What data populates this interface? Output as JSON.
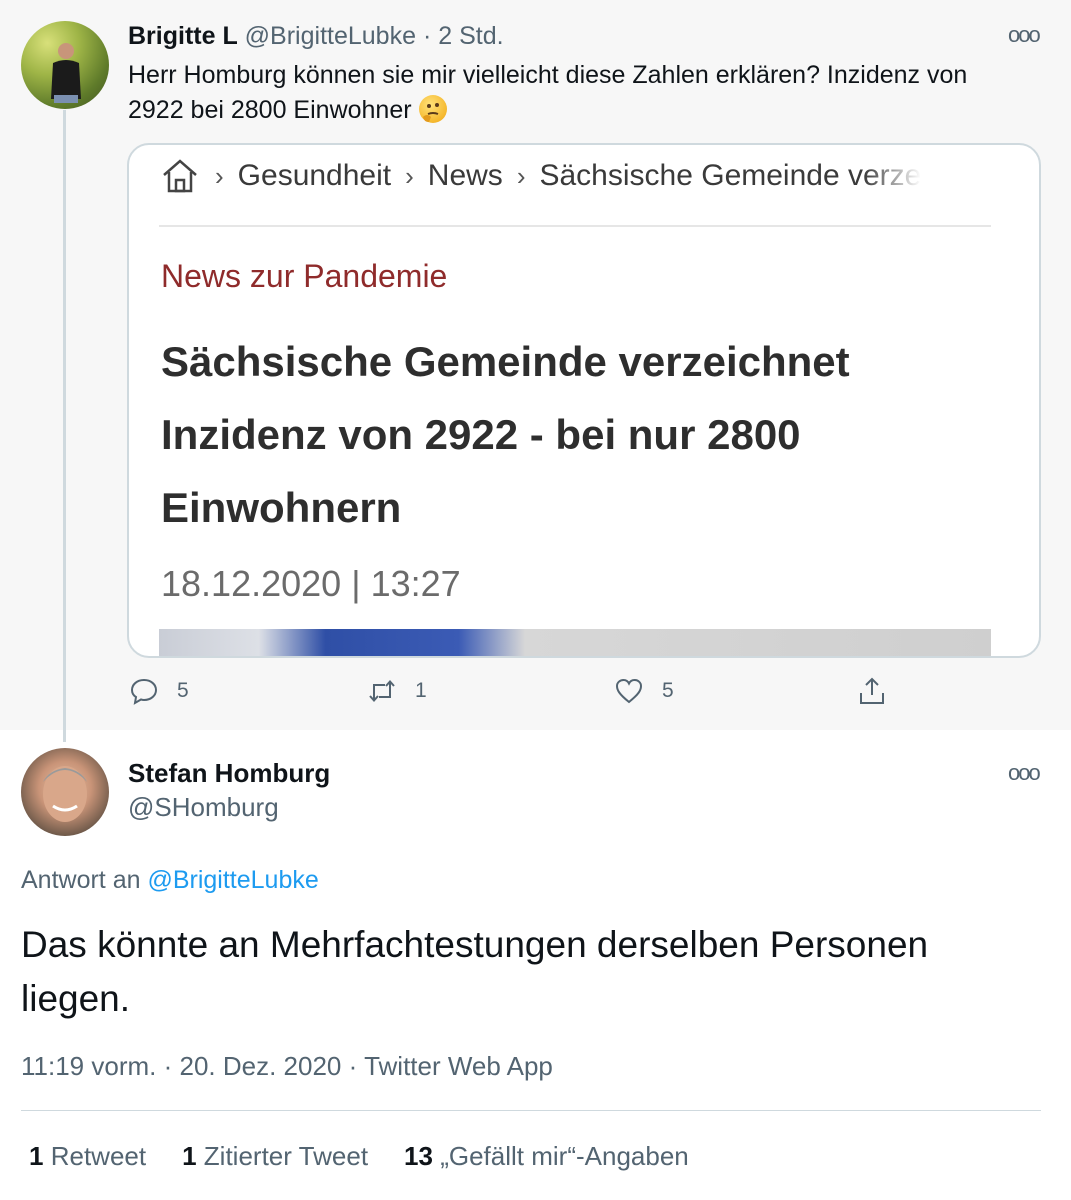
{
  "tweet1": {
    "name": "Brigitte L",
    "handle": "@BrigitteLubke",
    "separator": "·",
    "time": "2 Std.",
    "text": "Herr Homburg können sie mir vielleicht diese Zahlen erklären? Inzidenz von 2922 bei 2800 Einwohner",
    "emoji": "thinking-face-emoji",
    "card": {
      "breadcrumbs": [
        "Gesundheit",
        "News",
        "Sächsische Gemeinde verze"
      ],
      "kicker": "News zur Pandemie",
      "headline": "Sächsische Gemeinde verzeichnet Inzidenz von 2922 - bei nur 2800 Einwohnern",
      "date": "18.12.2020",
      "date_sep": "|",
      "clock": "13:27"
    },
    "actions": {
      "replies": "5",
      "retweets": "1",
      "likes": "5"
    }
  },
  "tweet2": {
    "name": "Stefan Homburg",
    "handle": "@SHomburg",
    "reply_prefix": "Antwort an",
    "reply_handle": "@BrigitteLubke",
    "text": "Das könnte an Mehrfachtestungen derselben Personen liegen.",
    "time": "11:19 vorm.",
    "date": "20. Dez. 2020",
    "source": "Twitter Web App",
    "dot": "·",
    "stats": [
      {
        "count": "1",
        "label": "Retweet"
      },
      {
        "count": "1",
        "label": "Zitierter Tweet"
      },
      {
        "count": "13",
        "label": "„Gefällt mir“-Angaben"
      }
    ]
  },
  "colors": {
    "link": "#1d9bf0",
    "muted": "#536471",
    "kicker": "#8f2b2b"
  }
}
